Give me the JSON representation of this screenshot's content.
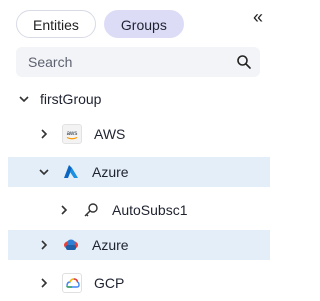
{
  "tabs": [
    {
      "label": "Entities"
    },
    {
      "label": "Groups"
    }
  ],
  "collapse_icon": "«",
  "search": {
    "placeholder": "Search"
  },
  "tree": {
    "root": {
      "label": "firstGroup"
    },
    "items": [
      {
        "label": "AWS",
        "icon": "aws-icon"
      },
      {
        "label": "Azure",
        "icon": "azure-icon"
      },
      {
        "label": "AutoSubsc1",
        "icon": "key-icon"
      },
      {
        "label": "Azure",
        "icon": "azure-cloud-icon"
      },
      {
        "label": "GCP",
        "icon": "gcp-icon"
      }
    ]
  },
  "colors": {
    "selected_row": "#e3eef8",
    "active_tab": "#dcdcf7",
    "search_bg": "#f3f4f7"
  }
}
